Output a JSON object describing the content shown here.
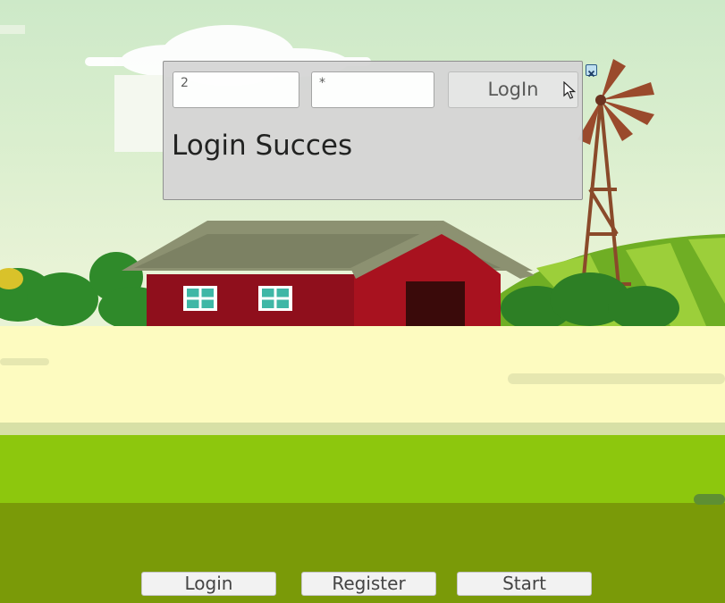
{
  "login_panel": {
    "username_value": "2",
    "password_value": "*",
    "login_button_label": "LogIn",
    "status_message": "Login Succes"
  },
  "menu": {
    "login_label": "Login",
    "register_label": "Register",
    "start_label": "Start"
  },
  "icons": {
    "close": "close-icon",
    "cursor": "mouse-pointer-icon"
  },
  "colors": {
    "sky": "#cde9c8",
    "barn_red": "#a0101e",
    "roof": "#8c9171",
    "path": "#fdfbc0",
    "grass_light": "#8dc70d",
    "grass_dark": "#7a9a08",
    "panel": "#d6d6d6"
  }
}
